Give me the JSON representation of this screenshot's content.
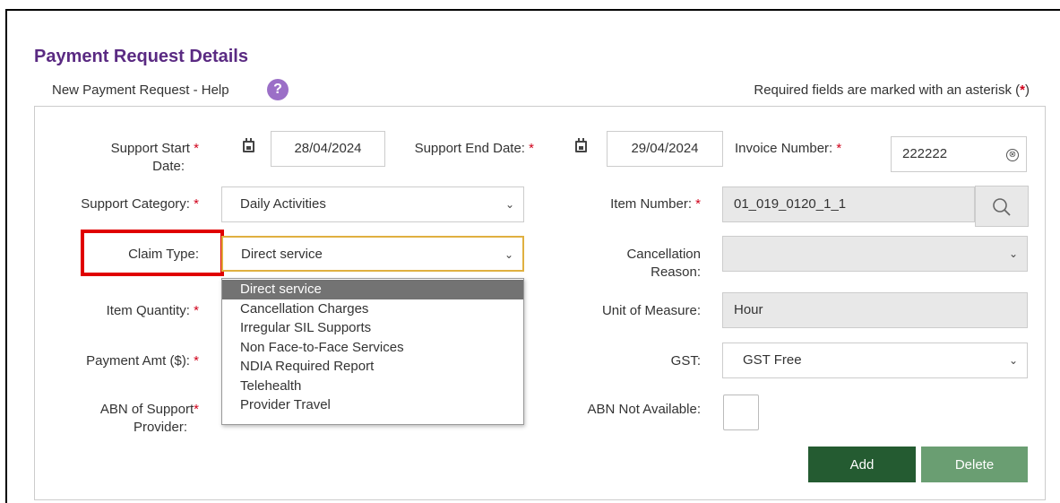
{
  "header": {
    "title": "Payment Request Details",
    "subtitle": "New Payment Request - Help",
    "help_icon": "?",
    "required_note_prefix": "Required fields are marked with an asterisk (",
    "required_note_star": "*",
    "required_note_suffix": ")"
  },
  "form": {
    "required_star": "*",
    "support_start_date": {
      "label_line1": "Support Start",
      "label_line2": "Date:",
      "value": "28/04/2024"
    },
    "support_end_date": {
      "label": "Support End Date:",
      "value": "29/04/2024"
    },
    "invoice_number": {
      "label": "Invoice Number:",
      "value": "222222",
      "clear_icon": "⊗"
    },
    "support_category": {
      "label": "Support Category:",
      "value": "Daily Activities"
    },
    "item_number": {
      "label": "Item Number:",
      "value": "01_019_0120_1_1"
    },
    "claim_type": {
      "label": "Claim Type:",
      "value": "Direct service"
    },
    "cancellation_reason": {
      "label_line1": "Cancellation",
      "label_line2": "Reason:",
      "value": ""
    },
    "item_quantity": {
      "label": "Item Quantity:"
    },
    "unit_of_measure": {
      "label": "Unit of Measure:",
      "value": "Hour"
    },
    "payment_amt": {
      "label": "Payment Amt ($):"
    },
    "gst": {
      "label": "GST:",
      "value": "GST Free"
    },
    "abn_support_provider": {
      "label_line1": "ABN of Support",
      "label_line2": "Provider:"
    },
    "abn_not_available": {
      "label": "ABN Not Available:"
    },
    "add_button": "Add",
    "delete_button": "Delete",
    "select_arrow": "⌄"
  },
  "claim_type_options": [
    "Direct service",
    "Cancellation Charges",
    "Irregular SIL Supports",
    "Non Face-to-Face Services",
    "NDIA Required Report",
    "Telehealth",
    "Provider Travel"
  ],
  "colors": {
    "title": "#5a2a82",
    "help_icon": "#9b6fc7",
    "required_star": "#d0021b",
    "add_button": "#245b31",
    "delete_button": "#6a9e72",
    "selected_option": "#737373",
    "highlight_box": "#e00000",
    "focused_select_border": "#e0b040"
  },
  "icons": {
    "calendar": "calendar-icon",
    "search": "search-icon",
    "clear": "clear-icon",
    "help": "help-icon",
    "dropdown": "chevron-down-icon"
  }
}
